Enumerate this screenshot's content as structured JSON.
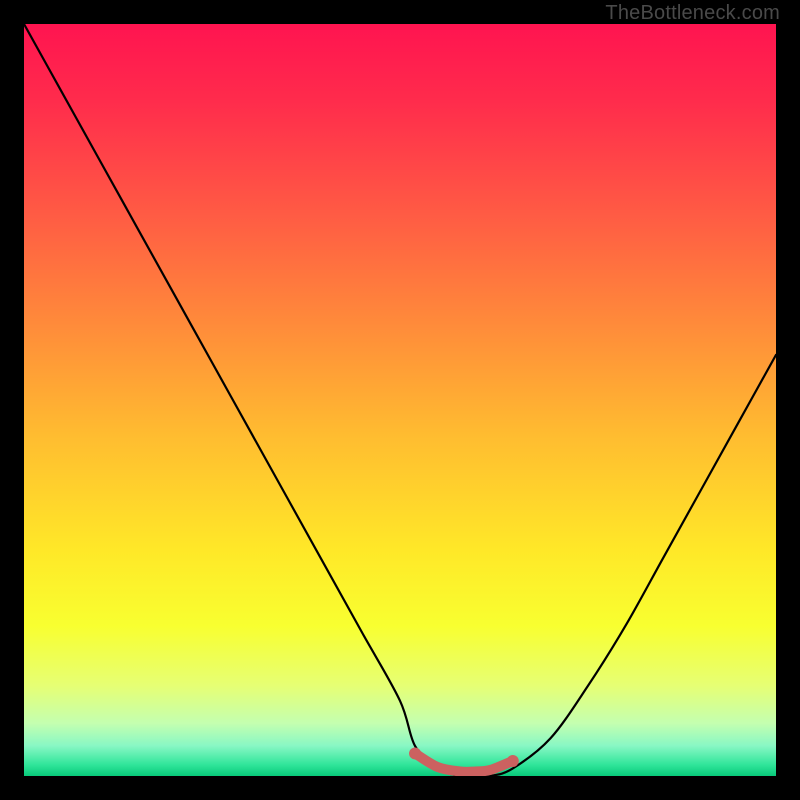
{
  "watermark": "TheBottleneck.com",
  "chart_data": {
    "type": "line",
    "title": "",
    "xlabel": "",
    "ylabel": "",
    "xlim": [
      0,
      100
    ],
    "ylim": [
      0,
      100
    ],
    "series": [
      {
        "name": "curve",
        "x": [
          0,
          5,
          10,
          15,
          20,
          25,
          30,
          35,
          40,
          45,
          50,
          52,
          55,
          58,
          60,
          62,
          65,
          70,
          75,
          80,
          85,
          90,
          95,
          100
        ],
        "y": [
          100,
          91,
          82,
          73,
          64,
          55,
          46,
          37,
          28,
          19,
          10,
          4,
          1,
          0,
          0,
          0,
          1,
          5,
          12,
          20,
          29,
          38,
          47,
          56
        ]
      }
    ],
    "valley_marker": {
      "name": "valley-band",
      "color": "#cc6160",
      "x": [
        52,
        55,
        58,
        60,
        62,
        65
      ],
      "y": [
        3,
        1.2,
        0.6,
        0.6,
        0.8,
        2
      ]
    },
    "background_gradient_stops": [
      {
        "offset": 0.0,
        "color": "#ff1450"
      },
      {
        "offset": 0.1,
        "color": "#ff2b4c"
      },
      {
        "offset": 0.25,
        "color": "#ff5a44"
      },
      {
        "offset": 0.4,
        "color": "#ff8b3a"
      },
      {
        "offset": 0.55,
        "color": "#ffbd30"
      },
      {
        "offset": 0.7,
        "color": "#ffe828"
      },
      {
        "offset": 0.8,
        "color": "#f8ff30"
      },
      {
        "offset": 0.88,
        "color": "#e6ff74"
      },
      {
        "offset": 0.93,
        "color": "#c4ffb0"
      },
      {
        "offset": 0.96,
        "color": "#88f7c4"
      },
      {
        "offset": 0.985,
        "color": "#30e59a"
      },
      {
        "offset": 1.0,
        "color": "#08c97a"
      }
    ]
  }
}
